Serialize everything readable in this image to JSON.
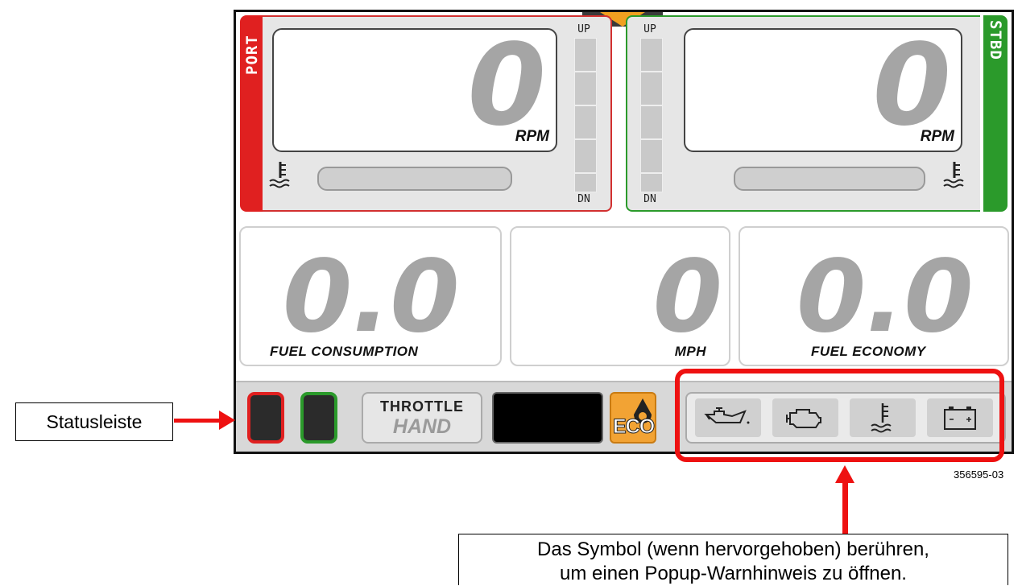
{
  "engines": {
    "port": {
      "side_label": "PORT",
      "rpm_value": "0",
      "rpm_unit": "RPM",
      "trim_up": "UP",
      "trim_dn": "DN",
      "color": "#e02020"
    },
    "stbd": {
      "side_label": "STBD",
      "rpm_value": "0",
      "rpm_unit": "RPM",
      "trim_up": "UP",
      "trim_dn": "DN",
      "color": "#2b9a2b"
    }
  },
  "gauges": {
    "fuel_consumption": {
      "value": "0.0",
      "label": "FUEL CONSUMPTION"
    },
    "speed": {
      "value": "0",
      "label": "MPH"
    },
    "fuel_economy": {
      "value": "0.0",
      "label": "FUEL ECONOMY"
    }
  },
  "status_bar": {
    "throttle_label": "THROTTLE",
    "throttle_mode": "HAND",
    "eco_label": "ECO",
    "warning_icons": [
      "oil-pressure-icon",
      "check-engine-icon",
      "coolant-temp-icon",
      "battery-icon"
    ]
  },
  "callouts": {
    "status_bar_label": "Statusleiste",
    "notice_line1": "Das Symbol (wenn hervorgehoben) berühren,",
    "notice_line2": "um einen Popup-Warnhinweis zu öffnen.",
    "figure_code": "356595-03"
  },
  "colors": {
    "highlight": "#ee1111",
    "eco": "#f2a334",
    "port": "#e02020",
    "stbd": "#2b9a2b"
  }
}
